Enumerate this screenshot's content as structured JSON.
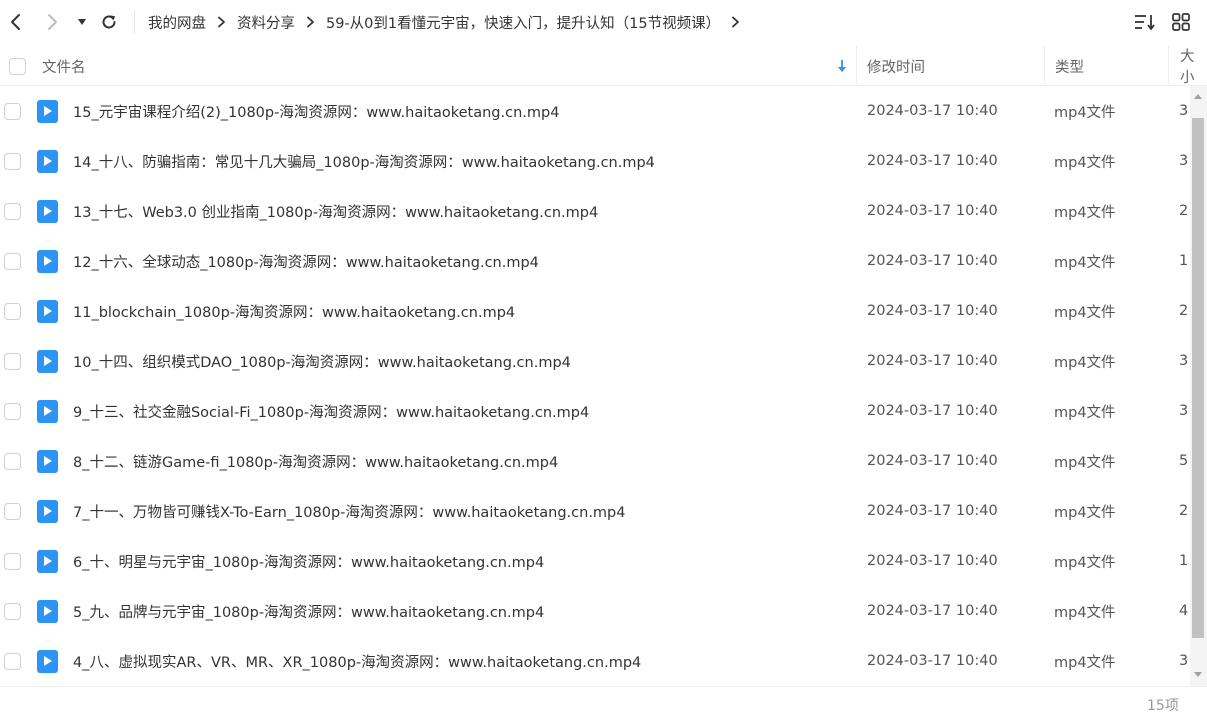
{
  "nav": {
    "back_icon": "chevron-left-icon",
    "forward_icon": "chevron-right-icon",
    "dropdown_icon": "caret-down-icon",
    "refresh_icon": "refresh-icon"
  },
  "breadcrumb": [
    {
      "label": "我的网盘"
    },
    {
      "label": "资料分享"
    },
    {
      "label": "59-从0到1看懂元宇宙，快速入门，提升认知（15节视频课）"
    }
  ],
  "toolbar": {
    "sort_icon": "sort-list-icon",
    "grid_icon": "grid-view-icon"
  },
  "table": {
    "columns": {
      "name": "文件名",
      "mtime": "修改时间",
      "type": "类型",
      "size": "大小"
    },
    "rows": [
      {
        "name": "15_元宇宙课程介绍(2)_1080p-海淘资源网：www.haitaoketang.cn.mp4",
        "mtime": "2024-03-17 10:40",
        "type": "mp4文件",
        "size": "3"
      },
      {
        "name": "14_十八、防骗指南：常见十几大骗局_1080p-海淘资源网：www.haitaoketang.cn.mp4",
        "mtime": "2024-03-17 10:40",
        "type": "mp4文件",
        "size": "3"
      },
      {
        "name": "13_十七、Web3.0 创业指南_1080p-海淘资源网：www.haitaoketang.cn.mp4",
        "mtime": "2024-03-17 10:40",
        "type": "mp4文件",
        "size": "2"
      },
      {
        "name": "12_十六、全球动态_1080p-海淘资源网：www.haitaoketang.cn.mp4",
        "mtime": "2024-03-17 10:40",
        "type": "mp4文件",
        "size": "1"
      },
      {
        "name": "11_blockchain_1080p-海淘资源网：www.haitaoketang.cn.mp4",
        "mtime": "2024-03-17 10:40",
        "type": "mp4文件",
        "size": "2"
      },
      {
        "name": "10_十四、组织模式DAO_1080p-海淘资源网：www.haitaoketang.cn.mp4",
        "mtime": "2024-03-17 10:40",
        "type": "mp4文件",
        "size": "3"
      },
      {
        "name": "9_十三、社交金融Social-Fi_1080p-海淘资源网：www.haitaoketang.cn.mp4",
        "mtime": "2024-03-17 10:40",
        "type": "mp4文件",
        "size": "3"
      },
      {
        "name": "8_十二、链游Game-fi_1080p-海淘资源网：www.haitaoketang.cn.mp4",
        "mtime": "2024-03-17 10:40",
        "type": "mp4文件",
        "size": "5"
      },
      {
        "name": "7_十一、万物皆可赚钱X-To-Earn_1080p-海淘资源网：www.haitaoketang.cn.mp4",
        "mtime": "2024-03-17 10:40",
        "type": "mp4文件",
        "size": "2"
      },
      {
        "name": "6_十、明星与元宇宙_1080p-海淘资源网：www.haitaoketang.cn.mp4",
        "mtime": "2024-03-17 10:40",
        "type": "mp4文件",
        "size": "1"
      },
      {
        "name": "5_九、品牌与元宇宙_1080p-海淘资源网：www.haitaoketang.cn.mp4",
        "mtime": "2024-03-17 10:40",
        "type": "mp4文件",
        "size": "4"
      },
      {
        "name": "4_八、虚拟现实AR、VR、MR、XR_1080p-海淘资源网：www.haitaoketang.cn.mp4",
        "mtime": "2024-03-17 10:40",
        "type": "mp4文件",
        "size": "3"
      }
    ]
  },
  "footer": {
    "count": "15项"
  },
  "colors": {
    "accent": "#2c94f5",
    "text": "#333333",
    "muted": "#999999"
  }
}
